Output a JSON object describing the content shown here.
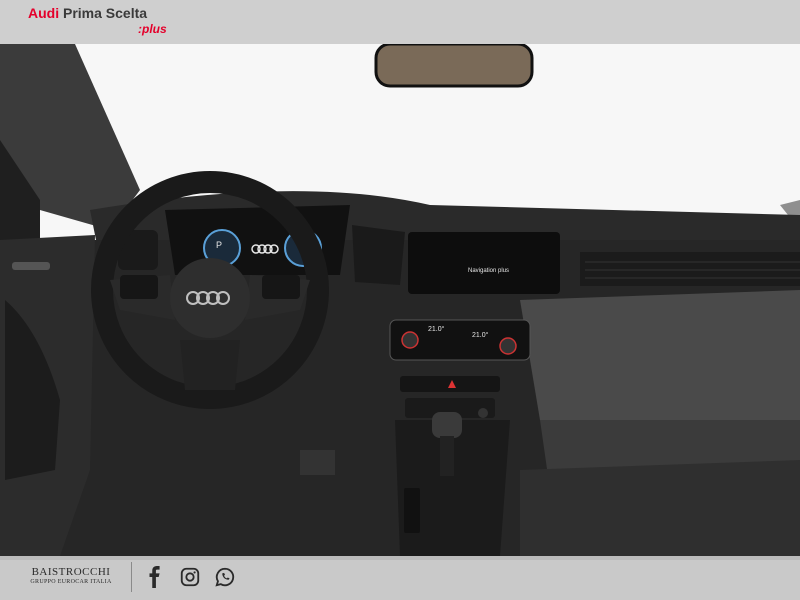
{
  "brand": {
    "audi": "Audi",
    "prima": "Prima Scelta",
    "plus": ":plus"
  },
  "cluster": {
    "gear": "P"
  },
  "mmi": {
    "screen_text": "Navigation plus"
  },
  "climate": {
    "left_temp": "21.0°",
    "right_temp": "21.0°"
  },
  "dealer": {
    "name": "BAISTROCCHI",
    "subtitle": "GRUPPO EUROCAR ITALIA"
  },
  "social": [
    "facebook-icon",
    "instagram-icon",
    "whatsapp-icon"
  ],
  "colors": {
    "accent": "#e4002b",
    "band": "#cfcfcf"
  }
}
